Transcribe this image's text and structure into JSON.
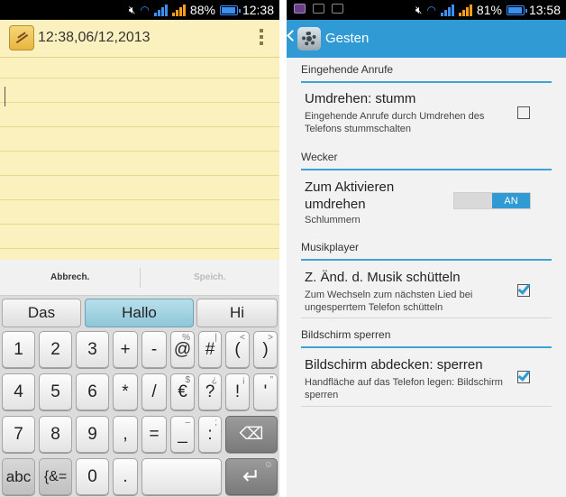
{
  "left_status": {
    "battery": "88%",
    "time": "12:38"
  },
  "note": {
    "title": "12:38,06/12,2013"
  },
  "keyboard": {
    "actions": {
      "cancel": "Abbrech.",
      "save": "Speich."
    },
    "suggestions": [
      "Das",
      "Hallo",
      "Hi"
    ],
    "rows": [
      [
        {
          "main": "1"
        },
        {
          "main": "2"
        },
        {
          "main": "3"
        },
        {
          "main": "+"
        },
        {
          "main": "-"
        },
        {
          "main": "@",
          "sub": "%"
        },
        {
          "main": "#",
          "sub": "|"
        },
        {
          "main": "(",
          "sub": "<"
        },
        {
          "main": ")",
          "sub": ">"
        }
      ],
      [
        {
          "main": "4"
        },
        {
          "main": "5"
        },
        {
          "main": "6"
        },
        {
          "main": "*"
        },
        {
          "main": "/"
        },
        {
          "main": "€",
          "sub": "$"
        },
        {
          "main": "?",
          "sub": "¿"
        },
        {
          "main": "!",
          "sub": "¡"
        },
        {
          "main": "'",
          "sub": "\""
        }
      ],
      [
        {
          "main": "7"
        },
        {
          "main": "8"
        },
        {
          "main": "9"
        },
        {
          "main": ","
        },
        {
          "main": "="
        },
        {
          "main": "_",
          "sub": "–"
        },
        {
          "main": ":",
          "sub": ";"
        },
        {
          "main": "⌫"
        }
      ],
      [
        {
          "main": "abc"
        },
        {
          "main": "{&="
        },
        {
          "main": "0"
        },
        {
          "main": "."
        },
        {
          "main": ""
        },
        {
          "main": "↵",
          "sub": "☺"
        }
      ]
    ]
  },
  "right_status": {
    "battery": "81%",
    "time": "13:58"
  },
  "settings": {
    "title": "Gesten",
    "sections": [
      {
        "header": "Eingehende Anrufe",
        "title": "Umdrehen: stumm",
        "summary": "Eingehende Anrufe durch Umdrehen des Telefons stummschalten",
        "control": "checkbox",
        "checked": false
      },
      {
        "header": "Wecker",
        "title": "Zum Aktivieren umdrehen",
        "summary": "Schlummern",
        "control": "toggle",
        "toggle_label": "AN"
      },
      {
        "header": "Musikplayer",
        "title": "Z. Änd. d. Musik schütteln",
        "summary": "Zum Wechseln zum nächsten Lied bei ungesperrtem Telefon schütteln",
        "control": "checkbox",
        "checked": true
      },
      {
        "header": "Bildschirm sperren",
        "title": "Bildschirm abdecken: sperren",
        "summary": "Handfläche auf das Telefon legen: Bildschirm sperren",
        "control": "checkbox",
        "checked": true
      }
    ]
  },
  "colors": {
    "accent": "#2f9ad4",
    "note_paper": "#fbf1bf",
    "suggestion_selected": "#8ec6d8"
  }
}
